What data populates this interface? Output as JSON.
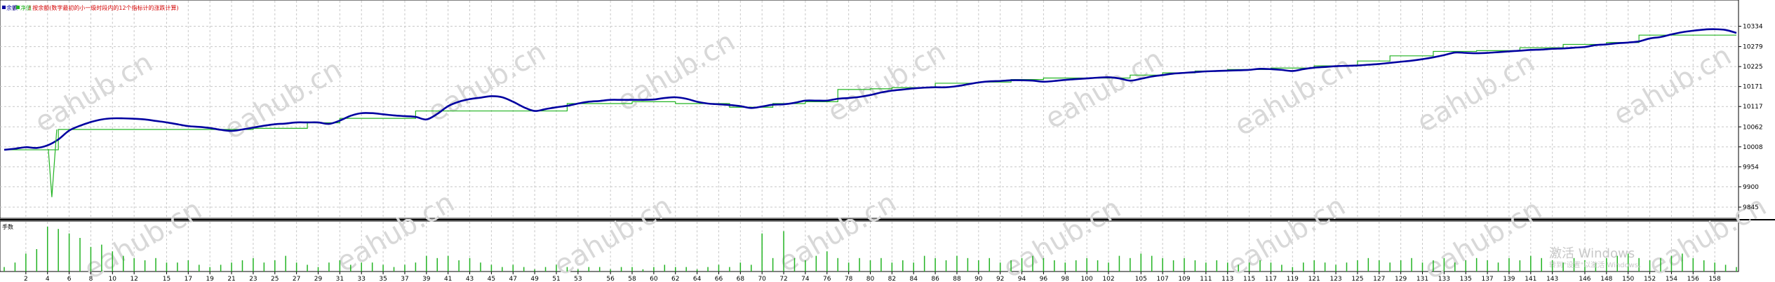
{
  "legend": {
    "balance_label": "余额",
    "equity_label": "净值",
    "note": "/ 按余额(数字最初的小一级时段内的12个指标计的涨跌计算)"
  },
  "volume_panel": {
    "label": "手数"
  },
  "watermark": "eahub.cn",
  "windows_watermark": {
    "title": "激活 Windows",
    "subtitle": "转到\"设置\"以激活 Windows。"
  },
  "colors": {
    "balance": "#0000a0",
    "equity": "#22b322",
    "grid": "#c8c8c8",
    "volume_bars": "#22b322",
    "legend_note": "#d40000",
    "axis_text": "#000000"
  },
  "chart_data": [
    {
      "type": "line",
      "title": "",
      "x_ticks": [
        "2",
        "4",
        "6",
        "8",
        "10",
        "12",
        "15",
        "17",
        "19",
        "21",
        "23",
        "25",
        "27",
        "29",
        "31",
        "33",
        "35",
        "37",
        "39",
        "41",
        "43",
        "45",
        "47",
        "49",
        "51",
        "53",
        "56",
        "58",
        "60",
        "62",
        "64",
        "66",
        "68",
        "70",
        "72",
        "74",
        "76",
        "78",
        "80",
        "82",
        "84",
        "86",
        "88",
        "90",
        "92",
        "94",
        "96",
        "98",
        "100",
        "102",
        "105",
        "107",
        "109",
        "111",
        "113",
        "115",
        "117",
        "119",
        "121",
        "123",
        "125",
        "127",
        "129",
        "131",
        "133",
        "135",
        "137",
        "139",
        "141",
        "143",
        "146",
        "148",
        "150",
        "152",
        "154",
        "156",
        "158"
      ],
      "y_ticks": [
        "10334",
        "10279",
        "10225",
        "10171",
        "10117",
        "10062",
        "10008",
        "9954",
        "9900",
        "9845"
      ],
      "ylim": [
        9845,
        10352
      ],
      "xlim": [
        0,
        160
      ],
      "grid": true,
      "legend_position": "top-left",
      "series": [
        {
          "name": "余额",
          "x": [
            0,
            4,
            5,
            10,
            20,
            23,
            28,
            31,
            37,
            38,
            47,
            52,
            58,
            62,
            67,
            71,
            74,
            77,
            80,
            82,
            86,
            90,
            93,
            96,
            99,
            104,
            107,
            110,
            113,
            117,
            121,
            125,
            128,
            132,
            136,
            140,
            144,
            148,
            151,
            156,
            160
          ],
          "values": [
            10000,
            10000,
            10055,
            10055,
            10055,
            10058,
            10073,
            10085,
            10085,
            10105,
            10105,
            10125,
            10130,
            10125,
            10115,
            10125,
            10130,
            10163,
            10165,
            10168,
            10180,
            10183,
            10190,
            10194,
            10194,
            10202,
            10208,
            10213,
            10217,
            10221,
            10227,
            10240,
            10254,
            10266,
            10268,
            10276,
            10285,
            10290,
            10310,
            10310,
            10310
          ]
        },
        {
          "name": "净值",
          "x": [
            0,
            1,
            2,
            3,
            4,
            5,
            6,
            7,
            8,
            9,
            10,
            11,
            12,
            13,
            14,
            15,
            16,
            17,
            18,
            19,
            20,
            21,
            22,
            23,
            24,
            25,
            26,
            27,
            28,
            29,
            30,
            31,
            32,
            33,
            34,
            35,
            36,
            37,
            38,
            39,
            40,
            41,
            42,
            43,
            44,
            45,
            46,
            47,
            48,
            49,
            50,
            51,
            52,
            53,
            54,
            55,
            56,
            57,
            58,
            59,
            60,
            61,
            62,
            63,
            64,
            65,
            66,
            67,
            68,
            69,
            70,
            71,
            72,
            73,
            74,
            75,
            76,
            77,
            78,
            79,
            80,
            81,
            82,
            83,
            84,
            85,
            86,
            87,
            88,
            89,
            90,
            91,
            92,
            93,
            94,
            95,
            96,
            97,
            98,
            99,
            100,
            101,
            102,
            103,
            104,
            105,
            106,
            107,
            108,
            109,
            110,
            111,
            112,
            113,
            114,
            115,
            116,
            117,
            118,
            119,
            120,
            121,
            122,
            123,
            124,
            125,
            126,
            127,
            128,
            129,
            130,
            131,
            132,
            133,
            134,
            135,
            136,
            137,
            138,
            139,
            140,
            141,
            142,
            143,
            144,
            145,
            146,
            147,
            148,
            149,
            150,
            151,
            152,
            153,
            154,
            155,
            156,
            157,
            158,
            159,
            160
          ],
          "values": [
            10000,
            10003,
            10007,
            10005,
            10012,
            10028,
            10052,
            10065,
            10075,
            10082,
            10085,
            10085,
            10084,
            10082,
            10078,
            10074,
            10069,
            10064,
            10062,
            10059,
            10054,
            10051,
            10055,
            10060,
            10065,
            10069,
            10071,
            10074,
            10074,
            10074,
            10070,
            10079,
            10092,
            10099,
            10099,
            10096,
            10093,
            10091,
            10089,
            10082,
            10097,
            10118,
            10130,
            10137,
            10141,
            10145,
            10142,
            10130,
            10115,
            10105,
            10110,
            10115,
            10119,
            10125,
            10130,
            10132,
            10135,
            10135,
            10135,
            10135,
            10136,
            10140,
            10142,
            10138,
            10130,
            10125,
            10123,
            10121,
            10118,
            10113,
            10117,
            10122,
            10123,
            10127,
            10133,
            10133,
            10133,
            10138,
            10140,
            10143,
            10148,
            10155,
            10160,
            10163,
            10166,
            10168,
            10169,
            10169,
            10172,
            10177,
            10182,
            10185,
            10186,
            10188,
            10188,
            10187,
            10184,
            10186,
            10189,
            10191,
            10193,
            10195,
            10196,
            10193,
            10187,
            10192,
            10198,
            10202,
            10206,
            10208,
            10210,
            10212,
            10213,
            10214,
            10215,
            10216,
            10219,
            10218,
            10216,
            10213,
            10218,
            10222,
            10224,
            10226,
            10227,
            10228,
            10230,
            10232,
            10235,
            10238,
            10241,
            10245,
            10250,
            10256,
            10263,
            10262,
            10261,
            10262,
            10264,
            10266,
            10268,
            10270,
            10271,
            10273,
            10274,
            10276,
            10278,
            10283,
            10285,
            10288,
            10290,
            10293,
            10301,
            10305,
            10312,
            10318,
            10322,
            10325,
            10326,
            10324,
            10316
          ]
        }
      ]
    },
    {
      "type": "bar",
      "title": "",
      "ylabel": "手数",
      "x": [
        0,
        1,
        2,
        3,
        4,
        5,
        6,
        7,
        8,
        9,
        10,
        11,
        12,
        13,
        14,
        15,
        16,
        17,
        18,
        19,
        20,
        21,
        22,
        23,
        24,
        25,
        26,
        27,
        28,
        29,
        30,
        31,
        32,
        33,
        34,
        35,
        36,
        37,
        38,
        39,
        40,
        41,
        42,
        43,
        44,
        45,
        46,
        47,
        48,
        49,
        50,
        51,
        52,
        53,
        54,
        55,
        56,
        57,
        58,
        59,
        60,
        61,
        62,
        63,
        64,
        65,
        66,
        67,
        68,
        69,
        70,
        71,
        72,
        73,
        74,
        75,
        76,
        77,
        78,
        79,
        80,
        81,
        82,
        83,
        84,
        85,
        86,
        87,
        88,
        89,
        90,
        91,
        92,
        93,
        94,
        95,
        96,
        97,
        98,
        99,
        100,
        101,
        102,
        103,
        104,
        105,
        106,
        107,
        108,
        109,
        110,
        111,
        112,
        113,
        114,
        115,
        116,
        117,
        118,
        119,
        120,
        121,
        122,
        123,
        124,
        125,
        126,
        127,
        128,
        129,
        130,
        131,
        132,
        133,
        134,
        135,
        136,
        137,
        138,
        139,
        140,
        141,
        142,
        143,
        144,
        145,
        146,
        147,
        148,
        149,
        150,
        151,
        152,
        153,
        154,
        155,
        156,
        157,
        158,
        159,
        160
      ],
      "values": [
        0.1,
        0.2,
        0.4,
        0.5,
        1.0,
        0.95,
        0.85,
        0.75,
        0.55,
        0.6,
        0.45,
        0.35,
        0.3,
        0.25,
        0.3,
        0.2,
        0.2,
        0.25,
        0.15,
        0.1,
        0.15,
        0.2,
        0.25,
        0.3,
        0.2,
        0.25,
        0.35,
        0.2,
        0.15,
        0.1,
        0.2,
        0.25,
        0.15,
        0.2,
        0.2,
        0.15,
        0.1,
        0.15,
        0.2,
        0.35,
        0.3,
        0.35,
        0.25,
        0.3,
        0.2,
        0.15,
        0.1,
        0.15,
        0.1,
        0.05,
        0.1,
        0.15,
        0.1,
        0.05,
        0.1,
        0.1,
        0.05,
        0.1,
        0.1,
        0.05,
        0.1,
        0.15,
        0.1,
        0.1,
        0.05,
        0.1,
        0.15,
        0.1,
        0.2,
        0.15,
        0.85,
        0.3,
        0.9,
        0.3,
        0.25,
        0.35,
        0.45,
        0.3,
        0.2,
        0.3,
        0.25,
        0.3,
        0.2,
        0.25,
        0.2,
        0.35,
        0.3,
        0.25,
        0.35,
        0.3,
        0.25,
        0.3,
        0.2,
        0.25,
        0.3,
        0.35,
        0.3,
        0.25,
        0.2,
        0.25,
        0.3,
        0.25,
        0.2,
        0.35,
        0.3,
        0.4,
        0.35,
        0.3,
        0.25,
        0.3,
        0.25,
        0.2,
        0.25,
        0.2,
        0.15,
        0.2,
        0.25,
        0.2,
        0.15,
        0.1,
        0.2,
        0.25,
        0.2,
        0.15,
        0.2,
        0.25,
        0.3,
        0.25,
        0.2,
        0.25,
        0.3,
        0.2,
        0.25,
        0.3,
        0.2,
        0.25,
        0.3,
        0.25,
        0.2,
        0.3,
        0.25,
        0.35,
        0.3,
        0.25,
        0.2,
        0.3,
        0.25,
        0.2,
        0.3,
        0.35,
        0.4,
        0.3,
        0.25,
        0.3,
        0.35,
        0.4,
        0.3,
        0.25,
        0.2,
        0.15,
        0.1
      ]
    }
  ]
}
